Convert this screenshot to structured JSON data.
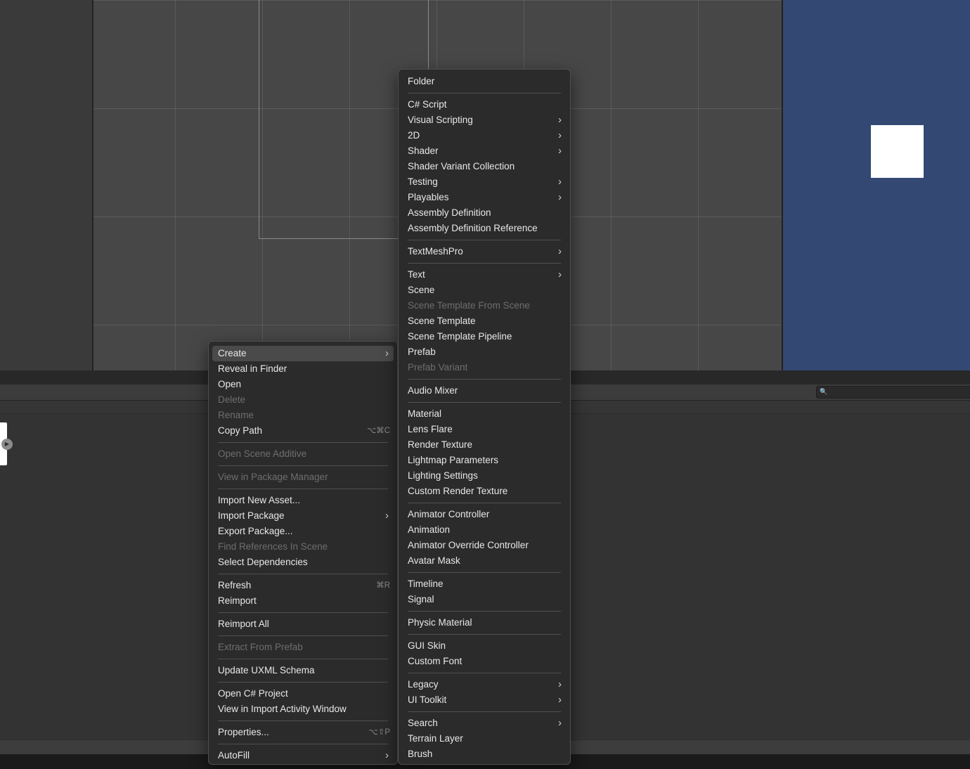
{
  "search": {
    "icon": "search-icon"
  },
  "context_menu": {
    "items": [
      {
        "label": "Create",
        "submenu": true,
        "highlighted": true
      },
      {
        "label": "Reveal in Finder"
      },
      {
        "label": "Open"
      },
      {
        "label": "Delete",
        "disabled": true
      },
      {
        "label": "Rename",
        "disabled": true
      },
      {
        "label": "Copy Path",
        "shortcut": "⌥⌘C"
      },
      {
        "separator": true
      },
      {
        "label": "Open Scene Additive",
        "disabled": true
      },
      {
        "separator": true
      },
      {
        "label": "View in Package Manager",
        "disabled": true
      },
      {
        "separator": true
      },
      {
        "label": "Import New Asset..."
      },
      {
        "label": "Import Package",
        "submenu": true
      },
      {
        "label": "Export Package..."
      },
      {
        "label": "Find References In Scene",
        "disabled": true
      },
      {
        "label": "Select Dependencies"
      },
      {
        "separator": true
      },
      {
        "label": "Refresh",
        "shortcut": "⌘R"
      },
      {
        "label": "Reimport"
      },
      {
        "separator": true
      },
      {
        "label": "Reimport All"
      },
      {
        "separator": true
      },
      {
        "label": "Extract From Prefab",
        "disabled": true
      },
      {
        "separator": true
      },
      {
        "label": "Update UXML Schema"
      },
      {
        "separator": true
      },
      {
        "label": "Open C# Project"
      },
      {
        "label": "View in Import Activity Window"
      },
      {
        "separator": true
      },
      {
        "label": "Properties...",
        "shortcut": "⌥⇧P"
      },
      {
        "separator": true
      },
      {
        "label": "AutoFill",
        "submenu": true
      }
    ]
  },
  "create_submenu": {
    "items": [
      {
        "label": "Folder"
      },
      {
        "separator": true
      },
      {
        "label": "C# Script"
      },
      {
        "label": "Visual Scripting",
        "submenu": true
      },
      {
        "label": "2D",
        "submenu": true
      },
      {
        "label": "Shader",
        "submenu": true
      },
      {
        "label": "Shader Variant Collection"
      },
      {
        "label": "Testing",
        "submenu": true
      },
      {
        "label": "Playables",
        "submenu": true
      },
      {
        "label": "Assembly Definition"
      },
      {
        "label": "Assembly Definition Reference"
      },
      {
        "separator": true
      },
      {
        "label": "TextMeshPro",
        "submenu": true
      },
      {
        "separator": true
      },
      {
        "label": "Text",
        "submenu": true
      },
      {
        "label": "Scene"
      },
      {
        "label": "Scene Template From Scene",
        "disabled": true
      },
      {
        "label": "Scene Template"
      },
      {
        "label": "Scene Template Pipeline"
      },
      {
        "label": "Prefab"
      },
      {
        "label": "Prefab Variant",
        "disabled": true
      },
      {
        "separator": true
      },
      {
        "label": "Audio Mixer"
      },
      {
        "separator": true
      },
      {
        "label": "Material"
      },
      {
        "label": "Lens Flare"
      },
      {
        "label": "Render Texture"
      },
      {
        "label": "Lightmap Parameters"
      },
      {
        "label": "Lighting Settings"
      },
      {
        "label": "Custom Render Texture"
      },
      {
        "separator": true
      },
      {
        "label": "Animator Controller"
      },
      {
        "label": "Animation"
      },
      {
        "label": "Animator Override Controller"
      },
      {
        "label": "Avatar Mask"
      },
      {
        "separator": true
      },
      {
        "label": "Timeline"
      },
      {
        "label": "Signal"
      },
      {
        "separator": true
      },
      {
        "label": "Physic Material"
      },
      {
        "separator": true
      },
      {
        "label": "GUI Skin"
      },
      {
        "label": "Custom Font"
      },
      {
        "separator": true
      },
      {
        "label": "Legacy",
        "submenu": true
      },
      {
        "label": "UI Toolkit",
        "submenu": true
      },
      {
        "separator": true
      },
      {
        "label": "Search",
        "submenu": true
      },
      {
        "label": "Terrain Layer"
      },
      {
        "label": "Brush"
      }
    ]
  },
  "colors": {
    "scene_bg": "#474747",
    "game_bg": "#344874",
    "menu_bg": "#2b2b2b",
    "highlight": "#4a4a4a"
  }
}
